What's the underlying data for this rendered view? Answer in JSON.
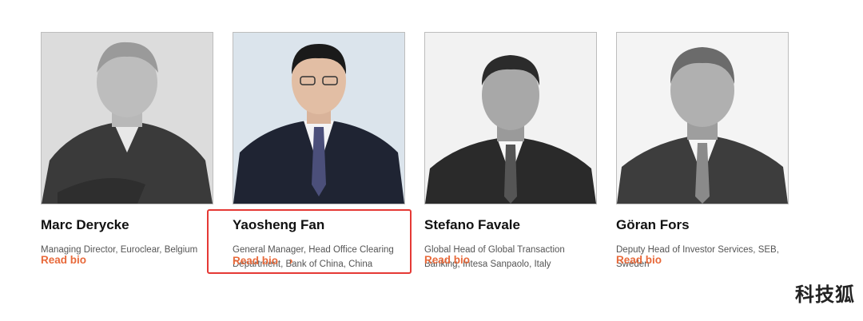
{
  "people": [
    {
      "name": "Marc Derycke",
      "title": "Managing Director, Euroclear, Belgium",
      "bio_label": "Read bio"
    },
    {
      "name": "Yaosheng Fan",
      "title": "General Manager, Head Office Clearing Department, Bank of China, China",
      "bio_label": "Read bio"
    },
    {
      "name": "Stefano Favale",
      "title": "Global Head of Global Transaction Banking, Intesa Sanpaolo, Italy",
      "bio_label": "Read bio"
    },
    {
      "name": "Göran Fors",
      "title": "Deputy Head of Investor Services, SEB, Sweden",
      "bio_label": "Read bio"
    }
  ],
  "watermark": "科技狐",
  "colors": {
    "accent": "#e8693a",
    "highlight": "#e53935"
  },
  "icons": {
    "bio_chevron": "chevron-right-icon"
  }
}
